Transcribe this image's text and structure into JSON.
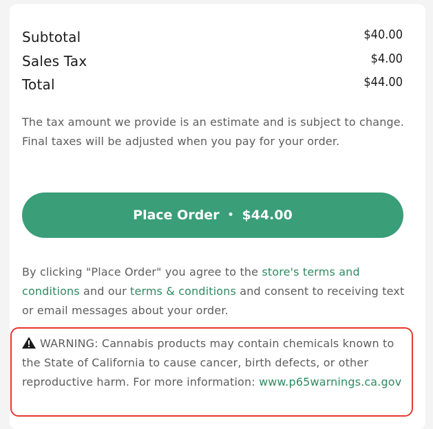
{
  "summary": {
    "subtotal_label": "Subtotal",
    "subtotal_value": "$40.00",
    "tax_label": "Sales Tax",
    "tax_value": "$4.00",
    "total_label": "Total",
    "total_value": "$44.00"
  },
  "tax_note": "The tax amount we provide is an estimate and is subject to change. Final taxes will be adjusted when you pay for your order.",
  "place_order": {
    "label": "Place Order",
    "separator": "•",
    "amount": "$44.00"
  },
  "consent": {
    "text_before": "By clicking \"Place Order\" you agree to the ",
    "store_terms_link": "store's terms and conditions",
    "text_middle": " and our ",
    "terms_link": "terms & conditions",
    "text_after": " and consent to receiving text or email messages about your order."
  },
  "warning": {
    "icon": "warning-triangle-icon",
    "text": "WARNING: Cannabis products may contain chemicals known to the State of California to cause cancer, birth defects, or other reproductive harm. For more information:",
    "link": "www.p65warnings.ca.gov"
  },
  "colors": {
    "accent_green": "#3a9e78",
    "link_green": "#2e8b61",
    "warning_red": "#e8352e"
  }
}
